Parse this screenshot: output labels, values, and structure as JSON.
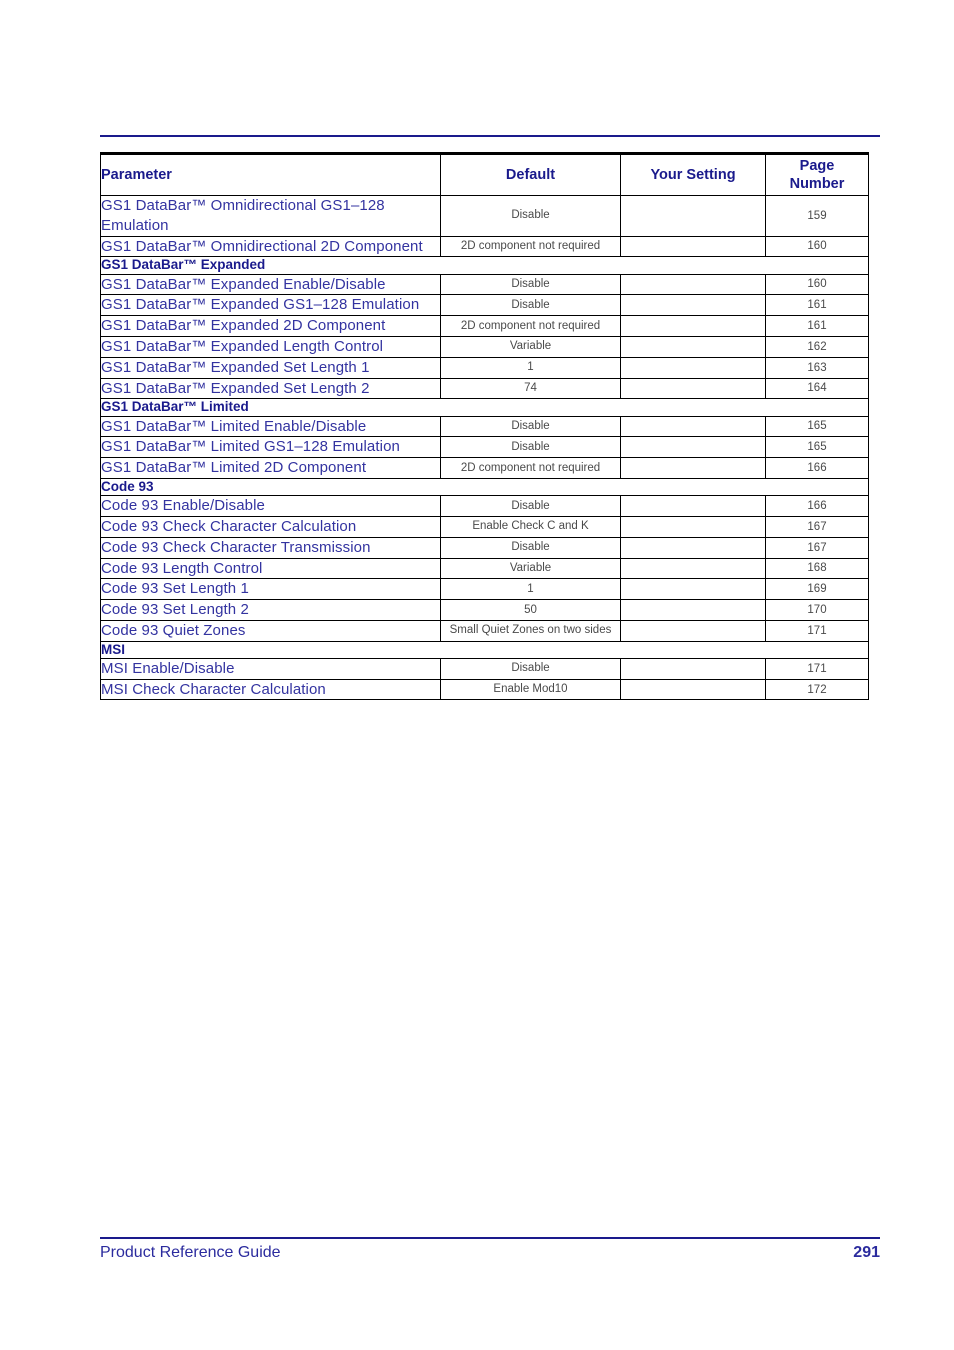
{
  "document": {
    "title": "Product Reference Guide",
    "page_number": "291",
    "accent_color": "#1a1a8c",
    "param_text_color": "#3333a0",
    "value_text_color": "#4a4a4a"
  },
  "table": {
    "columns": [
      {
        "label": "Parameter",
        "align": "left"
      },
      {
        "label": "Default",
        "align": "center"
      },
      {
        "label": "Your Setting",
        "align": "center"
      },
      {
        "label": "Page\nNumber",
        "align": "center"
      }
    ],
    "header": {
      "parameter": "Parameter",
      "default": "Default",
      "your_setting": "Your Setting",
      "page_number_line1": "Page",
      "page_number_line2": "Number"
    },
    "rows": [
      {
        "type": "data",
        "parameter": "GS1 DataBar™ Omnidirectional GS1–128 Emulation",
        "default": "Disable",
        "your_setting": "",
        "page": "159"
      },
      {
        "type": "data",
        "parameter": "GS1 DataBar™ Omnidirectional 2D Component",
        "default": "2D component not required",
        "your_setting": "",
        "page": "160"
      },
      {
        "type": "section",
        "parameter": "GS1 DataBar™ Expanded"
      },
      {
        "type": "data",
        "parameter": "GS1 DataBar™ Expanded Enable/Disable",
        "default": "Disable",
        "your_setting": "",
        "page": "160"
      },
      {
        "type": "data",
        "parameter": "GS1 DataBar™ Expanded GS1–128 Emulation",
        "default": "Disable",
        "your_setting": "",
        "page": "161"
      },
      {
        "type": "data",
        "parameter": "GS1 DataBar™ Expanded 2D Component",
        "default": "2D component not required",
        "your_setting": "",
        "page": "161"
      },
      {
        "type": "data",
        "parameter": "GS1 DataBar™ Expanded Length Control",
        "default": "Variable",
        "your_setting": "",
        "page": "162"
      },
      {
        "type": "data",
        "parameter": "GS1 DataBar™ Expanded Set Length 1",
        "default": "1",
        "your_setting": "",
        "page": "163"
      },
      {
        "type": "data",
        "parameter": "GS1 DataBar™ Expanded Set Length 2",
        "default": "74",
        "your_setting": "",
        "page": "164"
      },
      {
        "type": "section",
        "parameter": "GS1 DataBar™ Limited"
      },
      {
        "type": "data",
        "parameter": "GS1 DataBar™ Limited Enable/Disable",
        "default": "Disable",
        "your_setting": "",
        "page": "165"
      },
      {
        "type": "data",
        "parameter": "GS1 DataBar™ Limited GS1–128 Emulation",
        "default": "Disable",
        "your_setting": "",
        "page": "165"
      },
      {
        "type": "data",
        "parameter": "GS1 DataBar™ Limited 2D Component",
        "default": "2D component not required",
        "your_setting": "",
        "page": "166"
      },
      {
        "type": "section",
        "parameter": "Code 93"
      },
      {
        "type": "data",
        "parameter": "Code 93 Enable/Disable",
        "default": "Disable",
        "your_setting": "",
        "page": "166"
      },
      {
        "type": "data",
        "parameter": "Code 93 Check Character Calculation",
        "default": "Enable Check C and K",
        "your_setting": "",
        "page": "167"
      },
      {
        "type": "data",
        "parameter": "Code 93 Check Character Transmission",
        "default": "Disable",
        "your_setting": "",
        "page": "167"
      },
      {
        "type": "data",
        "parameter": "Code 93 Length Control",
        "default": "Variable",
        "your_setting": "",
        "page": "168"
      },
      {
        "type": "data",
        "parameter": "Code 93 Set Length 1",
        "default": "1",
        "your_setting": "",
        "page": "169"
      },
      {
        "type": "data",
        "parameter": "Code 93 Set Length 2",
        "default": "50",
        "your_setting": "",
        "page": "170"
      },
      {
        "type": "data",
        "parameter": "Code 93 Quiet Zones",
        "default": "Small Quiet Zones on two sides",
        "your_setting": "",
        "page": "171"
      },
      {
        "type": "section",
        "parameter": "MSI"
      },
      {
        "type": "data",
        "parameter": "MSI Enable/Disable",
        "default": "Disable",
        "your_setting": "",
        "page": "171"
      },
      {
        "type": "data",
        "parameter": "MSI Check Character Calculation",
        "default": "Enable Mod10",
        "your_setting": "",
        "page": "172"
      }
    ]
  },
  "footer": {
    "left": "Product Reference Guide",
    "right": "291"
  }
}
